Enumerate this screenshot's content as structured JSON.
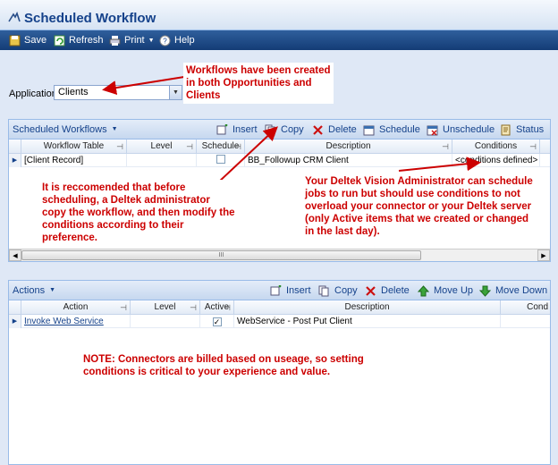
{
  "window": {
    "title": "Scheduled Workflow"
  },
  "toolbar": {
    "save": "Save",
    "refresh": "Refresh",
    "print": "Print",
    "help": "Help"
  },
  "application": {
    "label": "Application",
    "value": "Clients"
  },
  "workflows_panel": {
    "title": "Scheduled Workflows",
    "buttons": {
      "insert": "Insert",
      "copy": "Copy",
      "delete": "Delete",
      "schedule": "Schedule",
      "unschedule": "Unschedule",
      "status": "Status"
    },
    "columns": {
      "table": "Workflow Table",
      "level": "Level",
      "schedule": "Schedule",
      "description": "Description",
      "conditions": "Conditions"
    },
    "rows": [
      {
        "table": "[Client Record]",
        "level": "",
        "schedule": false,
        "description": "BB_Followup CRM Client",
        "conditions": "<conditions defined>"
      }
    ]
  },
  "actions_panel": {
    "title": "Actions",
    "buttons": {
      "insert": "Insert",
      "copy": "Copy",
      "delete": "Delete",
      "move_up": "Move Up",
      "move_down": "Move Down"
    },
    "columns": {
      "action": "Action",
      "level": "Level",
      "active": "Active",
      "description": "Description",
      "cond": "Cond"
    },
    "rows": [
      {
        "action": "Invoke Web Service",
        "level": "",
        "active": true,
        "description": "WebService - Post Put Client"
      }
    ]
  },
  "annotations": {
    "workflows": "Workflows have been created in both Opportunities and Clients",
    "recommend": "It is reccomended that before scheduling, a Deltek administrator copy the workflow, and then modify the conditions according to their preference.",
    "vision": "Your Deltek Vision Administrator can schedule jobs to run but should use conditions to not overload your connector or your Deltek server (only Active items that we created or changed in the last day).",
    "note": "NOTE:  Connectors are billed based on useage, so setting conditions is critical to your experience and value."
  },
  "scrollbar": {
    "grip": "III"
  },
  "colors": {
    "accent": "#15428b",
    "annotation": "#cc0000",
    "toolbar": "#1f4a87"
  }
}
